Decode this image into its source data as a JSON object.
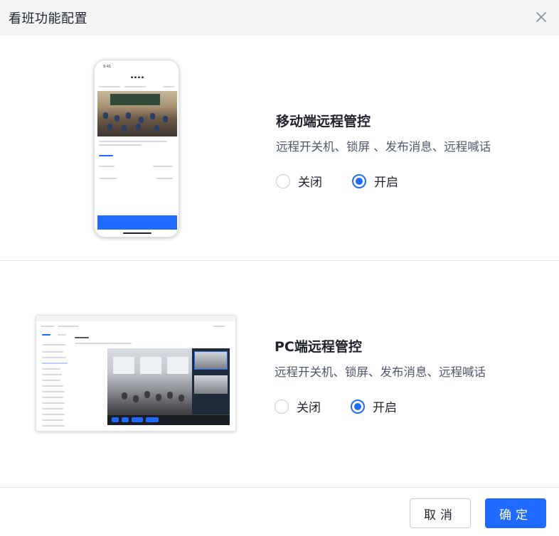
{
  "dialog": {
    "title": "看班功能配置",
    "close_icon": "close-icon"
  },
  "features": [
    {
      "title": "移动端远程管控",
      "description": "远程开关机、锁屏 、发布消息、远程喊话",
      "options": [
        {
          "label": "关闭",
          "checked": false
        },
        {
          "label": "开启",
          "checked": true
        }
      ]
    },
    {
      "title": "PC端远程管控",
      "description": "远程开关机、锁屏、发布消息、远程喊话",
      "options": [
        {
          "label": "关闭",
          "checked": false
        },
        {
          "label": "开启",
          "checked": true
        }
      ]
    }
  ],
  "footer": {
    "cancel_label": "取消",
    "ok_label": "确定"
  },
  "colors": {
    "primary": "#1f6bff",
    "header_bg": "#f3f4f6",
    "border": "#e5e6eb"
  }
}
